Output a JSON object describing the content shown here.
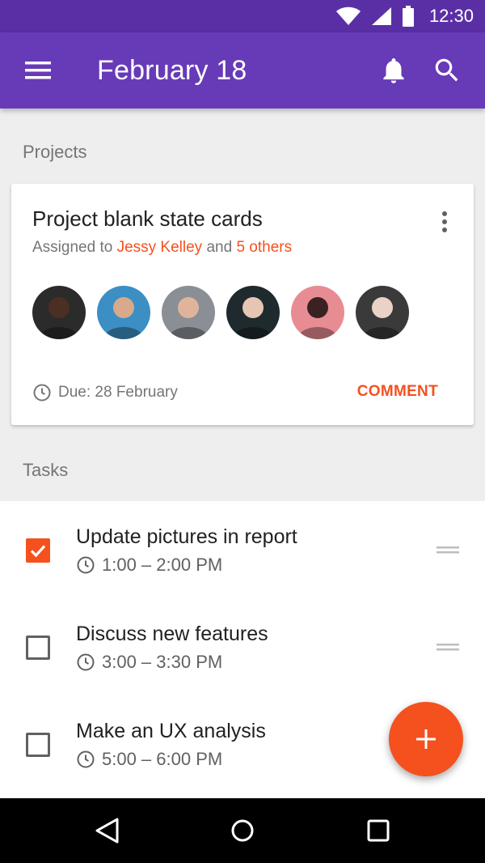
{
  "status_bar": {
    "time": "12:30"
  },
  "app_bar": {
    "title": "February 18"
  },
  "sections": {
    "projects_label": "Projects",
    "tasks_label": "Tasks"
  },
  "project_card": {
    "title": "Project blank state cards",
    "assigned_prefix": "Assigned to",
    "assignee": "Jessy Kelley",
    "conjunction": "and",
    "others": "5 others",
    "due": "Due: 28 February",
    "comment_label": "COMMENT",
    "avatars": [
      {
        "bg": "#2b2b2b",
        "skin": "#4a2f22"
      },
      {
        "bg": "#3c8fc4",
        "skin": "#d8a98a"
      },
      {
        "bg": "#8a8f95",
        "skin": "#e0b49a"
      },
      {
        "bg": "#1f2a2e",
        "skin": "#e6c6b3"
      },
      {
        "bg": "#e88c93",
        "skin": "#3a2222"
      },
      {
        "bg": "#3a3a3a",
        "skin": "#e9d2c6"
      }
    ]
  },
  "tasks": [
    {
      "title": "Update pictures in report",
      "time": "1:00 – 2:00 PM",
      "checked": true
    },
    {
      "title": "Discuss new features",
      "time": "3:00 – 3:30 PM",
      "checked": false
    },
    {
      "title": "Make an UX analysis",
      "time": "5:00 – 6:00 PM",
      "checked": false
    }
  ],
  "colors": {
    "primary": "#673ab7",
    "primary_dark": "#5a2fa6",
    "accent": "#f4511e"
  },
  "icons": {
    "status": [
      "wifi-icon",
      "signal-icon",
      "battery-icon"
    ],
    "app_bar": [
      "menu-icon",
      "bell-icon",
      "search-icon"
    ],
    "nav": [
      "back-icon",
      "home-icon",
      "recents-icon"
    ]
  }
}
